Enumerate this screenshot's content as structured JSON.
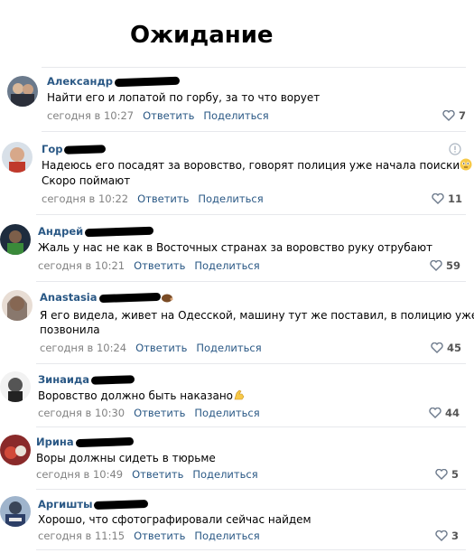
{
  "heading": "Ожидание",
  "comments": [
    {
      "author": "Александр",
      "text": "Найти его и лопатой по горбу, за то что ворует",
      "text2": "",
      "time": "сегодня в 10:27",
      "reply": "Ответить",
      "share": "Поделиться",
      "likes": "7"
    },
    {
      "author": "Гор",
      "text": "Надеюсь его посадят за воровство, говорят полиция уже начала поиски",
      "text2": "Скоро поймают",
      "time": "сегодня в 10:22",
      "reply": "Ответить",
      "share": "Поделиться",
      "likes": "11"
    },
    {
      "author": "Андрей",
      "text": "Жаль у нас не как в Восточных странах за воровство руку отрубают",
      "text2": "",
      "time": "сегодня в 10:21",
      "reply": "Ответить",
      "share": "Поделиться",
      "likes": "59"
    },
    {
      "author": "Anastasia",
      "text": "Я его видела, живет на Одесской, машину тут же поставил, в полицию уже",
      "text2": "позвонила",
      "time": "сегодня в 10:24",
      "reply": "Ответить",
      "share": "Поделиться",
      "likes": "45"
    },
    {
      "author": "Зинаида",
      "text": "Воровство должно быть наказано",
      "text2": "",
      "time": "сегодня в 10:30",
      "reply": "Ответить",
      "share": "Поделиться",
      "likes": "44"
    },
    {
      "author": "Ирина",
      "text": "Воры должны сидеть в тюрьме",
      "text2": "",
      "time": "сегодня в 10:49",
      "reply": "Ответить",
      "share": "Поделиться",
      "likes": "5"
    },
    {
      "author": "Аргишты",
      "text": "Хорошо, что сфотографировали сейчас найдем",
      "text2": "",
      "time": "сегодня в 11:15",
      "reply": "Ответить",
      "share": "Поделиться",
      "likes": "3"
    }
  ]
}
